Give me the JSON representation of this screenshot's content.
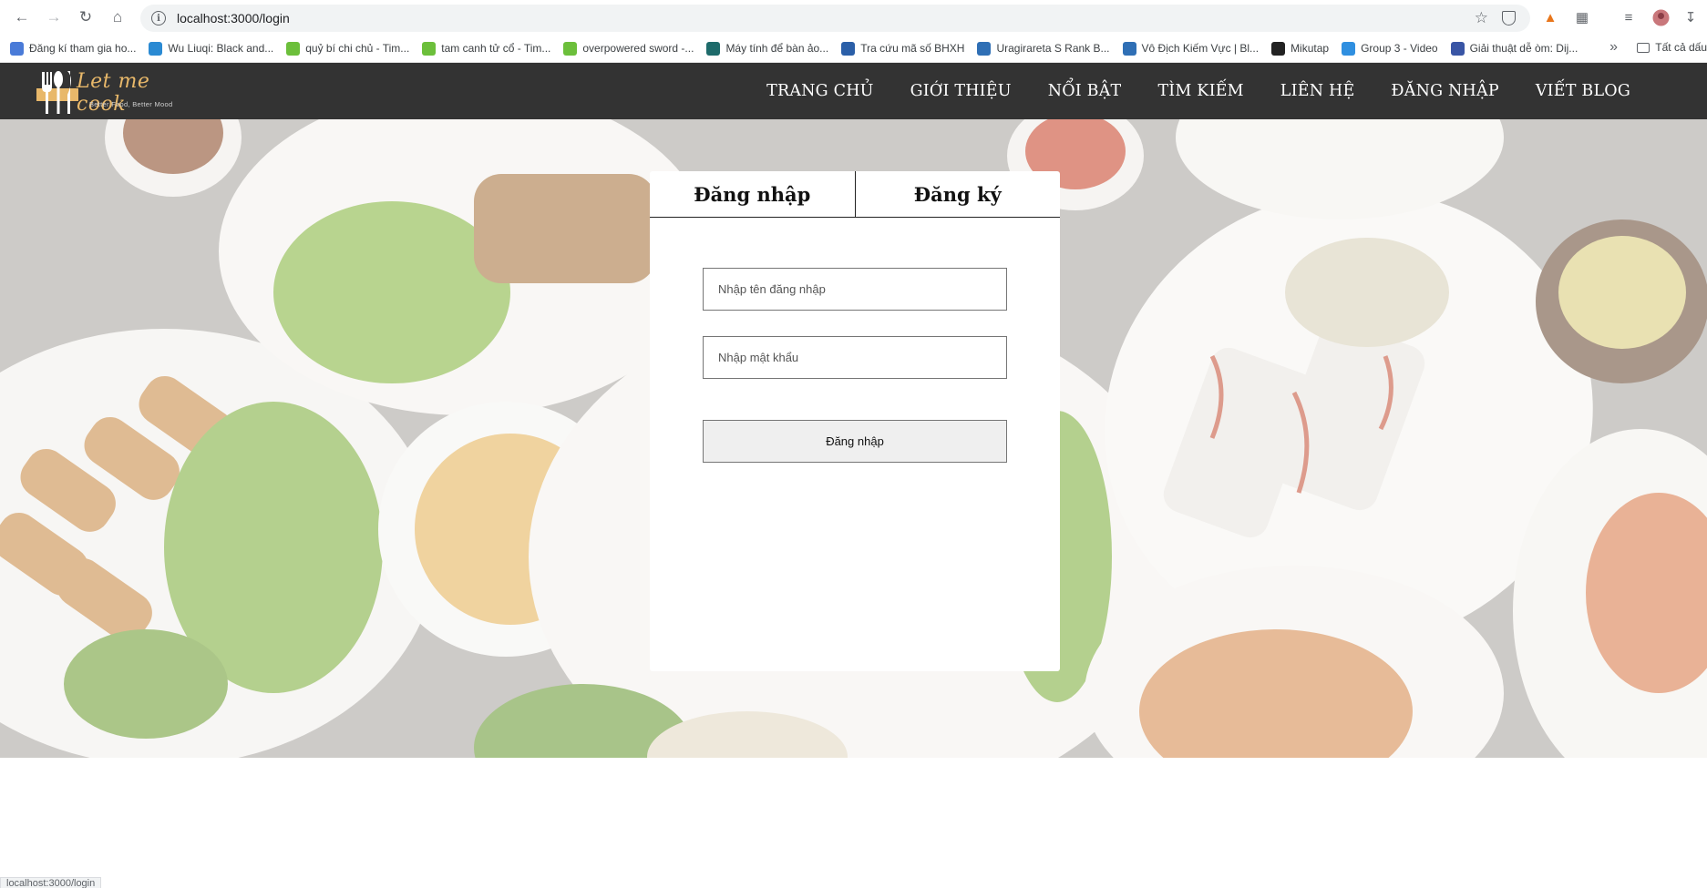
{
  "browser": {
    "url": "localhost:3000/login",
    "status_url": "localhost:3000/login",
    "bookmarks": [
      {
        "label": "Đăng kí tham gia ho...",
        "color": "#4a7bd8"
      },
      {
        "label": "Wu Liuqi: Black and...",
        "color": "#2a8ad3"
      },
      {
        "label": "quỷ bí chi chủ - Tim...",
        "color": "#6cbf3b"
      },
      {
        "label": "tam canh tử cổ - Tim...",
        "color": "#6cbf3b"
      },
      {
        "label": "overpowered sword -...",
        "color": "#6cbf3b"
      },
      {
        "label": "Máy tính để bàn ảo...",
        "color": "#1e6b6b"
      },
      {
        "label": "Tra cứu mã số BHXH",
        "color": "#2b5fa8"
      },
      {
        "label": "Uragirareta S Rank B...",
        "color": "#2f6fb5"
      },
      {
        "label": "Vô Địch Kiếm Vực | Bl...",
        "color": "#2f6fb5"
      },
      {
        "label": "Mikutap",
        "color": "#222222"
      },
      {
        "label": "Group 3 - Video",
        "color": "#2f8fe0"
      },
      {
        "label": "Giải thuật dễ òm: Dij...",
        "color": "#3955a5"
      }
    ],
    "more_label": "»",
    "folder_label": "Tất cả dấu"
  },
  "site": {
    "logo_script": "Let me cook",
    "logo_tagline": "Better Food, Better Mood",
    "brand_color": "#e8b86a",
    "header_color": "#333333",
    "menu": [
      "TRANG CHỦ",
      "GIỚI THIỆU",
      "NỔI BẬT",
      "TÌM KIẾM",
      "LIÊN HỆ",
      "ĐĂNG NHẬP",
      "VIẾT BLOG"
    ]
  },
  "login": {
    "tab_login": "Đăng nhập",
    "tab_register": "Đăng ký",
    "username_placeholder": "Nhập tên đăng nhập",
    "password_placeholder": "Nhập mật khẩu",
    "submit_label": "Đăng nhập"
  }
}
